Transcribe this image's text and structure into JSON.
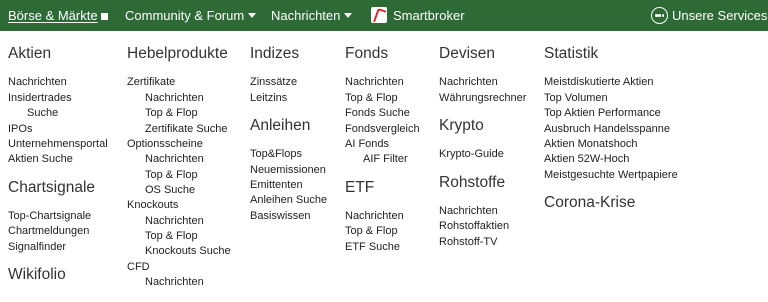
{
  "topnav": {
    "boerse": "Börse & Märkte",
    "community": "Community & Forum",
    "news": "Nachrichten",
    "smartbroker": "Smartbroker",
    "services": "Unsere Services"
  },
  "colors": {
    "nav_bg": "#2e6a36",
    "nav_text": "#ffffff"
  },
  "menu": {
    "aktien": {
      "heading": "Aktien",
      "items": [
        "Nachrichten",
        "Insidertrades",
        "Suche",
        "IPOs",
        "Unternehmensportal",
        "Aktien Suche"
      ]
    },
    "chartsignale": {
      "heading": "Chartsignale",
      "items": [
        "Top-Chartsignale",
        "Chartmeldungen",
        "Signalfinder"
      ]
    },
    "wikifolio": {
      "heading": "Wikifolio"
    },
    "hebel": {
      "heading": "Hebelprodukte",
      "items": [
        "Zertifikate",
        "Nachrichten",
        "Top & Flop",
        "Zertifikate Suche",
        "Optionsscheine",
        "Nachrichten",
        "Top & Flop",
        "OS Suche",
        "Knockouts",
        "Nachrichten",
        "Top & Flop",
        "Knockouts Suche",
        "CFD",
        "Nachrichten"
      ]
    },
    "indizes": {
      "heading": "Indizes",
      "items": [
        "Zinssätze",
        "Leitzins"
      ]
    },
    "anleihen": {
      "heading": "Anleihen",
      "items": [
        "Top&Flops",
        "Neuemissionen",
        "Emittenten",
        "Anleihen Suche",
        "Basiswissen"
      ]
    },
    "fonds": {
      "heading": "Fonds",
      "items": [
        "Nachrichten",
        "Top & Flop",
        "Fonds Suche",
        "Fondsvergleich",
        "AI Fonds",
        "AIF Filter"
      ]
    },
    "etf": {
      "heading": "ETF",
      "items": [
        "Nachrichten",
        "Top & Flop",
        "ETF Suche"
      ]
    },
    "devisen": {
      "heading": "Devisen",
      "items": [
        "Nachrichten",
        "Währungsrechner"
      ]
    },
    "krypto": {
      "heading": "Krypto",
      "items": [
        "Krypto-Guide"
      ]
    },
    "rohstoffe": {
      "heading": "Rohstoffe",
      "items": [
        "Nachrichten",
        "Rohstoffaktien",
        "Rohstoff-TV"
      ]
    },
    "statistik": {
      "heading": "Statistik",
      "items": [
        "Meistdiskutierte Aktien",
        "Top Volumen",
        "Top Aktien Performance",
        "Ausbruch Handelsspanne",
        "Aktien Monatshoch",
        "Aktien 52W-Hoch",
        "Meistgesuchte Wertpapiere"
      ]
    },
    "corona": {
      "heading": "Corona-Krise"
    }
  }
}
